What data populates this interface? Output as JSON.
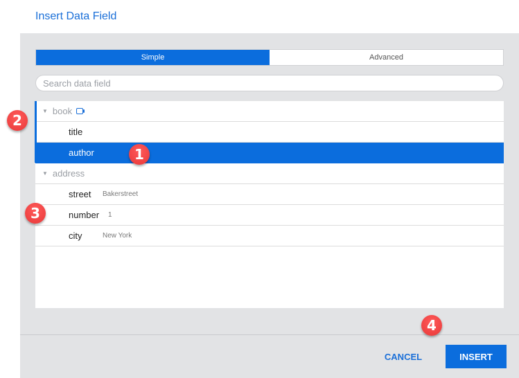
{
  "dialog": {
    "title": "Insert Data Field"
  },
  "tabs": [
    {
      "label": "Simple",
      "active": true
    },
    {
      "label": "Advanced",
      "active": false
    }
  ],
  "search": {
    "placeholder": "Search data field",
    "value": ""
  },
  "tree": {
    "groups": [
      {
        "label": "book",
        "icon": "data-source-icon",
        "fields": [
          {
            "name": "title",
            "value": ""
          },
          {
            "name": "author",
            "value": "",
            "selected": true
          }
        ]
      },
      {
        "label": "address",
        "fields": [
          {
            "name": "street",
            "value": "Bakerstreet"
          },
          {
            "name": "number",
            "value": "1"
          },
          {
            "name": "city",
            "value": "New York"
          }
        ]
      }
    ]
  },
  "footer": {
    "cancel_label": "CANCEL",
    "insert_label": "INSERT"
  },
  "annotations": [
    "1",
    "2",
    "3",
    "4"
  ],
  "colors": {
    "accent": "#0b6ddd",
    "badge": "#e83838",
    "panel": "#e2e3e5"
  }
}
